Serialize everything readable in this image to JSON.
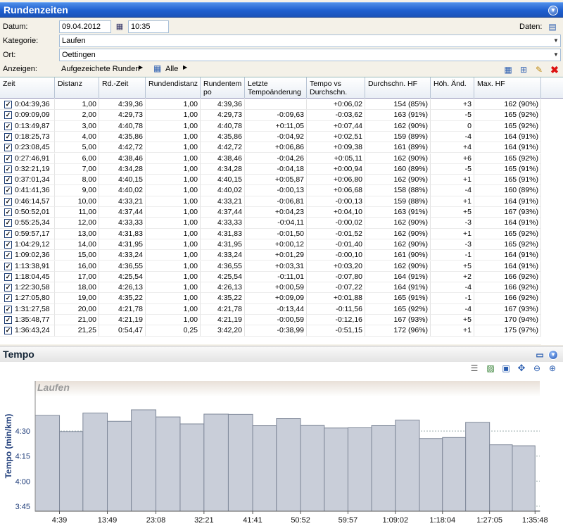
{
  "header": {
    "title": "Rundenzeiten"
  },
  "form": {
    "datum_label": "Datum:",
    "datum_value": "09.04.2012",
    "time_value": "10:35",
    "daten_label": "Daten:",
    "kategorie_label": "Kategorie:",
    "kategorie_value": "Laufen",
    "ort_label": "Ort:",
    "ort_value": "Oettingen",
    "anzeigen_label": "Anzeigen:",
    "laps_selector": "Aufgezeichete Runden",
    "filter_selector": "Alle"
  },
  "columns": [
    "Zeit",
    "Distanz",
    "Rd.-Zeit",
    "Rundendistanz",
    "Rundentem po",
    "Letzte Tempoänderung",
    "Tempo vs Durchschn.",
    "Durchschn. HF",
    "Höh. Änd.",
    "Max. HF"
  ],
  "rows": [
    [
      "0:04:39,36",
      "1,00",
      "4:39,36",
      "1,00",
      "4:39,36",
      "",
      "+0:06,02",
      "154 (85%)",
      "+3",
      "162 (90%)"
    ],
    [
      "0:09:09,09",
      "2,00",
      "4:29,73",
      "1,00",
      "4:29,73",
      "-0:09,63",
      "-0:03,62",
      "163 (91%)",
      "-5",
      "165 (92%)"
    ],
    [
      "0:13:49,87",
      "3,00",
      "4:40,78",
      "1,00",
      "4:40,78",
      "+0:11,05",
      "+0:07,44",
      "162 (90%)",
      "0",
      "165 (92%)"
    ],
    [
      "0:18:25,73",
      "4,00",
      "4:35,86",
      "1,00",
      "4:35,86",
      "-0:04,92",
      "+0:02,51",
      "159 (89%)",
      "-4",
      "164 (91%)"
    ],
    [
      "0:23:08,45",
      "5,00",
      "4:42,72",
      "1,00",
      "4:42,72",
      "+0:06,86",
      "+0:09,38",
      "161 (89%)",
      "+4",
      "164 (91%)"
    ],
    [
      "0:27:46,91",
      "6,00",
      "4:38,46",
      "1,00",
      "4:38,46",
      "-0:04,26",
      "+0:05,11",
      "162 (90%)",
      "+6",
      "165 (92%)"
    ],
    [
      "0:32:21,19",
      "7,00",
      "4:34,28",
      "1,00",
      "4:34,28",
      "-0:04,18",
      "+0:00,94",
      "160 (89%)",
      "-5",
      "165 (91%)"
    ],
    [
      "0:37:01,34",
      "8,00",
      "4:40,15",
      "1,00",
      "4:40,15",
      "+0:05,87",
      "+0:06,80",
      "162 (90%)",
      "+1",
      "165 (91%)"
    ],
    [
      "0:41:41,36",
      "9,00",
      "4:40,02",
      "1,00",
      "4:40,02",
      "-0:00,13",
      "+0:06,68",
      "158 (88%)",
      "-4",
      "160 (89%)"
    ],
    [
      "0:46:14,57",
      "10,00",
      "4:33,21",
      "1,00",
      "4:33,21",
      "-0:06,81",
      "-0:00,13",
      "159 (88%)",
      "+1",
      "164 (91%)"
    ],
    [
      "0:50:52,01",
      "11,00",
      "4:37,44",
      "1,00",
      "4:37,44",
      "+0:04,23",
      "+0:04,10",
      "163 (91%)",
      "+5",
      "167 (93%)"
    ],
    [
      "0:55:25,34",
      "12,00",
      "4:33,33",
      "1,00",
      "4:33,33",
      "-0:04,11",
      "-0:00,02",
      "162 (90%)",
      "-3",
      "164 (91%)"
    ],
    [
      "0:59:57,17",
      "13,00",
      "4:31,83",
      "1,00",
      "4:31,83",
      "-0:01,50",
      "-0:01,52",
      "162 (90%)",
      "+1",
      "165 (92%)"
    ],
    [
      "1:04:29,12",
      "14,00",
      "4:31,95",
      "1,00",
      "4:31,95",
      "+0:00,12",
      "-0:01,40",
      "162 (90%)",
      "-3",
      "165 (92%)"
    ],
    [
      "1:09:02,36",
      "15,00",
      "4:33,24",
      "1,00",
      "4:33,24",
      "+0:01,29",
      "-0:00,10",
      "161 (90%)",
      "-1",
      "164 (91%)"
    ],
    [
      "1:13:38,91",
      "16,00",
      "4:36,55",
      "1,00",
      "4:36,55",
      "+0:03,31",
      "+0:03,20",
      "162 (90%)",
      "+5",
      "164 (91%)"
    ],
    [
      "1:18:04,45",
      "17,00",
      "4:25,54",
      "1,00",
      "4:25,54",
      "-0:11,01",
      "-0:07,80",
      "164 (91%)",
      "+2",
      "166 (92%)"
    ],
    [
      "1:22:30,58",
      "18,00",
      "4:26,13",
      "1,00",
      "4:26,13",
      "+0:00,59",
      "-0:07,22",
      "164 (91%)",
      "-4",
      "166 (92%)"
    ],
    [
      "1:27:05,80",
      "19,00",
      "4:35,22",
      "1,00",
      "4:35,22",
      "+0:09,09",
      "+0:01,88",
      "165 (91%)",
      "-1",
      "166 (92%)"
    ],
    [
      "1:31:27,58",
      "20,00",
      "4:21,78",
      "1,00",
      "4:21,78",
      "-0:13,44",
      "-0:11,56",
      "165 (92%)",
      "-4",
      "167 (93%)"
    ],
    [
      "1:35:48,77",
      "21,00",
      "4:21,19",
      "1,00",
      "4:21,19",
      "-0:00,59",
      "-0:12,16",
      "167 (93%)",
      "+5",
      "170 (94%)"
    ],
    [
      "1:36:43,24",
      "21,25",
      "0:54,47",
      "0,25",
      "3:42,20",
      "-0:38,99",
      "-0:51,15",
      "172 (96%)",
      "+1",
      "175 (97%)"
    ]
  ],
  "chart_section": {
    "title": "Tempo"
  },
  "chart_data": {
    "type": "bar",
    "title": "Laufen",
    "ylabel": "Tempo (min/km)",
    "yticks": [
      "4:30",
      "4:15",
      "4:00",
      "3:45"
    ],
    "xticks": [
      "4:39",
      "13:49",
      "23:08",
      "32:21",
      "41:41",
      "50:52",
      "59:57",
      "1:09:02",
      "1:18:04",
      "1:27:05",
      "1:35:48"
    ],
    "grid": true,
    "x_end_minutes": [
      4.656,
      9.151,
      13.831,
      18.429,
      23.141,
      27.782,
      32.353,
      37.022,
      41.689,
      46.243,
      50.867,
      55.422,
      59.953,
      64.485,
      69.039,
      73.649,
      78.074,
      82.51,
      87.097,
      91.46,
      95.813,
      96.721
    ],
    "values_seconds": [
      279.36,
      269.73,
      280.78,
      275.86,
      282.72,
      278.46,
      274.28,
      280.15,
      280.02,
      273.21,
      277.44,
      273.33,
      271.83,
      271.95,
      273.24,
      276.55,
      265.54,
      266.13,
      275.22,
      261.78,
      261.19,
      222.2
    ]
  },
  "colors": {
    "header_blue": "#1e5fcf",
    "bar_fill": "#c9ced9",
    "bar_stroke": "#7f8899",
    "axis_text": "#1f3d7a"
  }
}
